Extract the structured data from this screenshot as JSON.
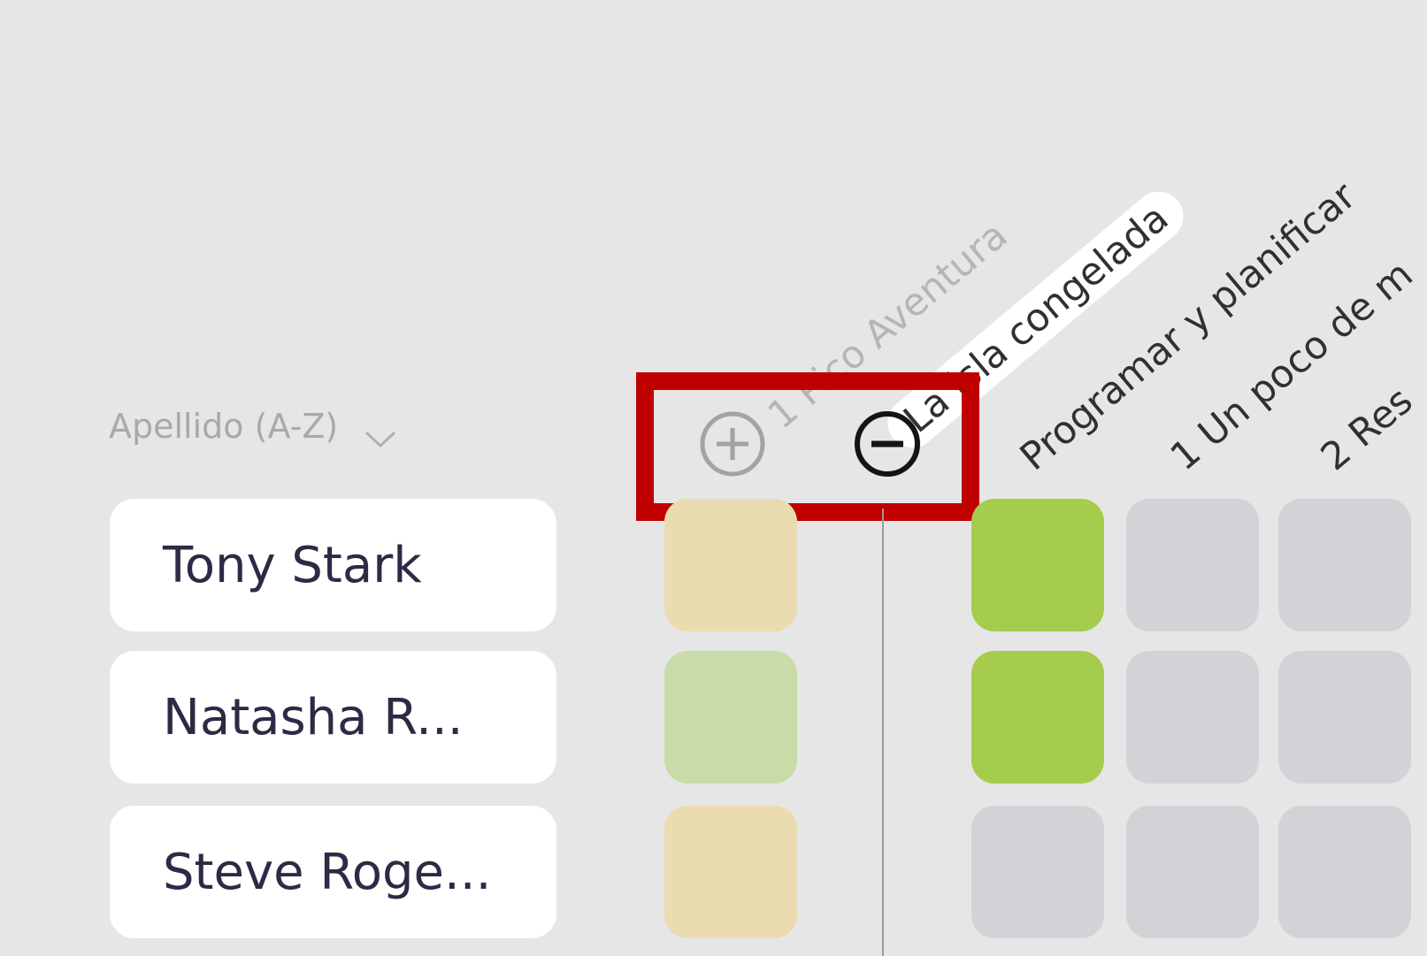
{
  "sort": {
    "label": "Apellido (A-Z)"
  },
  "zoom": {
    "in_icon": "plus-circle-icon",
    "out_icon": "minus-circle-icon"
  },
  "columns": [
    {
      "label": "1 Pico Aventura"
    },
    {
      "label": "La isla congelada"
    },
    {
      "label": "Programar y planificar"
    },
    {
      "label": "1 Un poco de m"
    },
    {
      "label": "2 Res"
    }
  ],
  "students": [
    {
      "name": "Tony Stark",
      "cells": [
        "pending",
        "completed",
        "empty",
        "empty"
      ]
    },
    {
      "name": "Natasha R...",
      "cells": [
        "in-progress",
        "completed",
        "empty",
        "empty"
      ]
    },
    {
      "name": "Steve Roge...",
      "cells": [
        "pending",
        "empty",
        "empty",
        "empty"
      ]
    }
  ],
  "colors": {
    "pending": "#eadbb0",
    "in-progress": "#c9dba8",
    "completed": "#a5cc4c",
    "empty": "#d1d3d7",
    "highlight": "#c00000"
  }
}
